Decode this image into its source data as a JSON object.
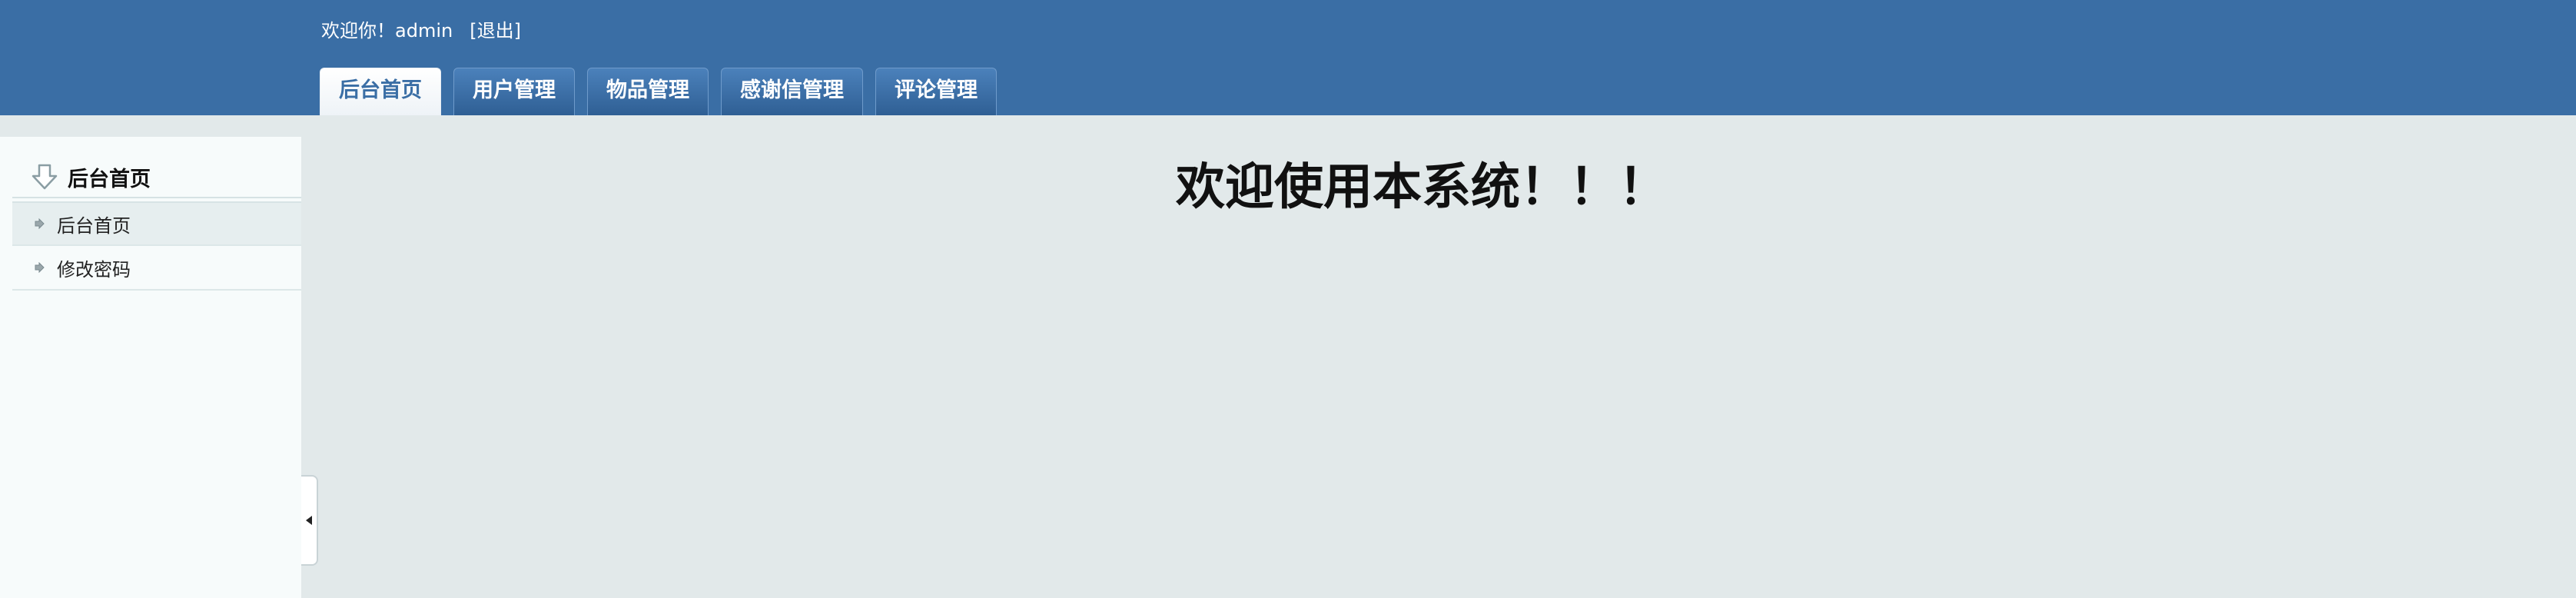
{
  "header": {
    "welcome_text": "欢迎你！admin",
    "logout_label": "[退出]",
    "tabs": [
      {
        "label": "后台首页",
        "active": true
      },
      {
        "label": "用户管理",
        "active": false
      },
      {
        "label": "物品管理",
        "active": false
      },
      {
        "label": "感谢信管理",
        "active": false
      },
      {
        "label": "评论管理",
        "active": false
      }
    ]
  },
  "sidebar": {
    "title": "后台首页",
    "items": [
      {
        "label": "后台首页",
        "active": true
      },
      {
        "label": "修改密码",
        "active": false
      }
    ]
  },
  "main": {
    "heading": "欢迎使用本系统！！！"
  },
  "colors": {
    "header_bg": "#3a6ea5",
    "content_bg": "#e2e9ea",
    "sidebar_bg": "#f7fbfb"
  }
}
